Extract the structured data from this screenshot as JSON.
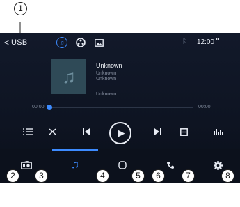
{
  "statusbar": {
    "back_glyph": "<",
    "source_label": "USB",
    "clock": "12:00",
    "icons": [
      "music-source-icon",
      "video-source-icon",
      "photo-source-icon",
      "bluetooth-icon"
    ]
  },
  "track": {
    "title": "Unknown",
    "artist": "Unknown",
    "album": "Unknown",
    "extra": "Unknown",
    "elapsed": "00:00",
    "total": "00:00",
    "progress": 0
  },
  "controls": [
    "playlist-icon",
    "shuffle-icon",
    "previous-icon",
    "play-icon",
    "next-icon",
    "repeat-icon",
    "equalizer-icon"
  ],
  "navbar": {
    "items": [
      "radio-icon",
      "music-icon",
      "home-icon",
      "phone-icon",
      "settings-icon"
    ],
    "active": "music-icon"
  },
  "callouts": [
    "1",
    "2",
    "3",
    "4",
    "5",
    "6",
    "7",
    "8"
  ],
  "colors": {
    "accent": "#3d8bff",
    "screen_bg": "#12192a",
    "navbar_bg": "#0c111c"
  }
}
